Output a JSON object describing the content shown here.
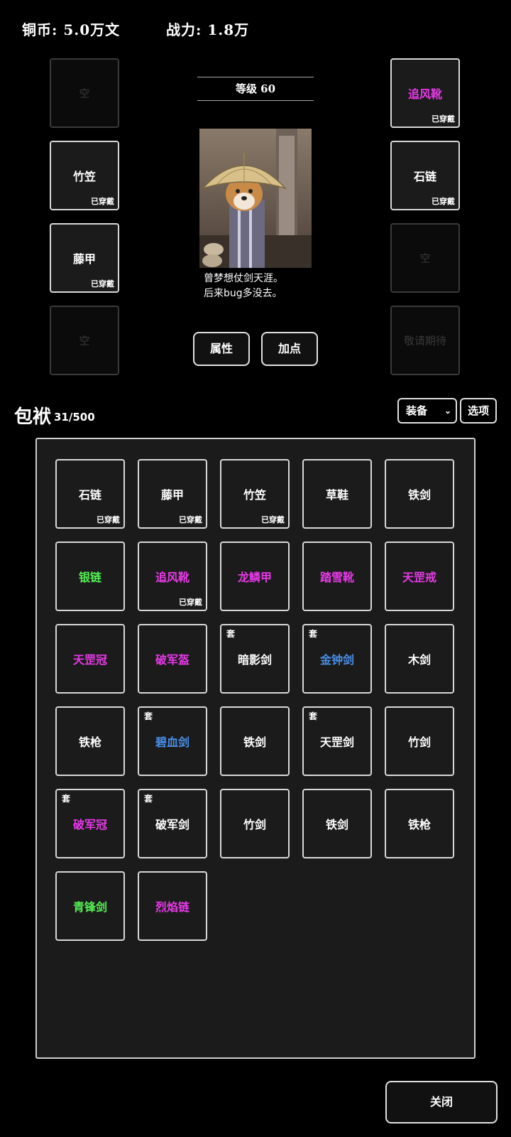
{
  "header": {
    "copper_label": "铜币:",
    "copper_value": "5.0万文",
    "power_label": "战力:",
    "power_value": "1.8万"
  },
  "colors": {
    "common": "#ffffff",
    "green": "#55ee55",
    "blue": "#4a8fe8",
    "purple": "#e83ae8",
    "empty": "#3a3a3a"
  },
  "character": {
    "level": "等级 60",
    "quote_line1": "曾梦想仗剑天涯。",
    "quote_line2": "后来bug多没去。"
  },
  "equipment": {
    "left": [
      {
        "name": "空",
        "worn": "",
        "rarity": "empty"
      },
      {
        "name": "竹笠",
        "worn": "已穿戴",
        "rarity": "common"
      },
      {
        "name": "藤甲",
        "worn": "已穿戴",
        "rarity": "common"
      },
      {
        "name": "空",
        "worn": "",
        "rarity": "empty"
      }
    ],
    "right": [
      {
        "name": "追风靴",
        "worn": "已穿戴",
        "rarity": "purple"
      },
      {
        "name": "石链",
        "worn": "已穿戴",
        "rarity": "common"
      },
      {
        "name": "空",
        "worn": "",
        "rarity": "empty"
      },
      {
        "name": "敬请期待",
        "worn": "",
        "rarity": "empty"
      }
    ]
  },
  "buttons": {
    "attributes": "属性",
    "add_points": "加点",
    "options": "选项",
    "close": "关闭"
  },
  "bag": {
    "title": "包袱",
    "count": "31/500",
    "filter_selected": "装备",
    "items": [
      {
        "name": "石链",
        "worn": "已穿戴",
        "set": "",
        "rarity": "common"
      },
      {
        "name": "藤甲",
        "worn": "已穿戴",
        "set": "",
        "rarity": "common"
      },
      {
        "name": "竹笠",
        "worn": "已穿戴",
        "set": "",
        "rarity": "common"
      },
      {
        "name": "草鞋",
        "worn": "",
        "set": "",
        "rarity": "common"
      },
      {
        "name": "铁剑",
        "worn": "",
        "set": "",
        "rarity": "common"
      },
      {
        "name": "银链",
        "worn": "",
        "set": "",
        "rarity": "green"
      },
      {
        "name": "追风靴",
        "worn": "已穿戴",
        "set": "",
        "rarity": "purple"
      },
      {
        "name": "龙鳞甲",
        "worn": "",
        "set": "",
        "rarity": "purple"
      },
      {
        "name": "踏雪靴",
        "worn": "",
        "set": "",
        "rarity": "purple"
      },
      {
        "name": "天罡戒",
        "worn": "",
        "set": "",
        "rarity": "purple"
      },
      {
        "name": "天罡冠",
        "worn": "",
        "set": "",
        "rarity": "purple"
      },
      {
        "name": "破军盔",
        "worn": "",
        "set": "",
        "rarity": "purple"
      },
      {
        "name": "暗影剑",
        "worn": "",
        "set": "套",
        "rarity": "common"
      },
      {
        "name": "金钟剑",
        "worn": "",
        "set": "套",
        "rarity": "blue"
      },
      {
        "name": "木剑",
        "worn": "",
        "set": "",
        "rarity": "common"
      },
      {
        "name": "铁枪",
        "worn": "",
        "set": "",
        "rarity": "common"
      },
      {
        "name": "碧血剑",
        "worn": "",
        "set": "套",
        "rarity": "blue"
      },
      {
        "name": "铁剑",
        "worn": "",
        "set": "",
        "rarity": "common"
      },
      {
        "name": "天罡剑",
        "worn": "",
        "set": "套",
        "rarity": "common"
      },
      {
        "name": "竹剑",
        "worn": "",
        "set": "",
        "rarity": "common"
      },
      {
        "name": "破军冠",
        "worn": "",
        "set": "套",
        "rarity": "purple"
      },
      {
        "name": "破军剑",
        "worn": "",
        "set": "套",
        "rarity": "common"
      },
      {
        "name": "竹剑",
        "worn": "",
        "set": "",
        "rarity": "common"
      },
      {
        "name": "铁剑",
        "worn": "",
        "set": "",
        "rarity": "common"
      },
      {
        "name": "铁枪",
        "worn": "",
        "set": "",
        "rarity": "common"
      },
      {
        "name": "青锋剑",
        "worn": "",
        "set": "",
        "rarity": "green"
      },
      {
        "name": "烈焰链",
        "worn": "",
        "set": "",
        "rarity": "purple"
      }
    ]
  }
}
